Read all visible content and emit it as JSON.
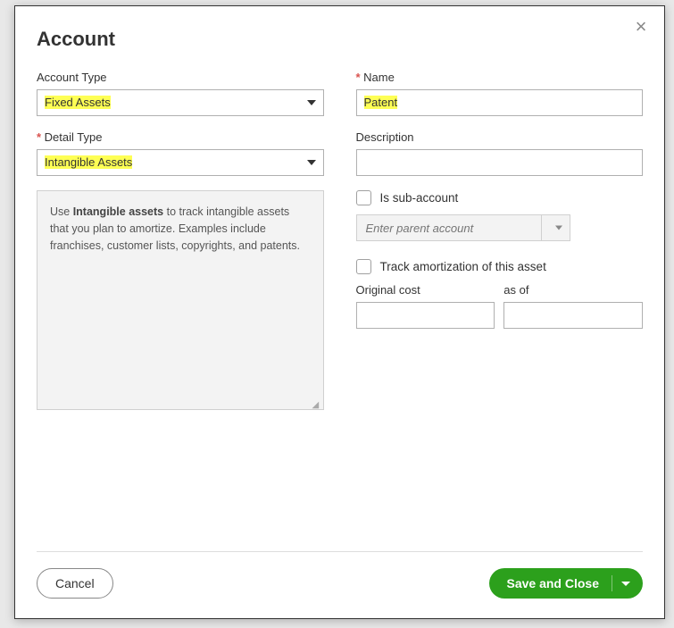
{
  "modal": {
    "title": "Account"
  },
  "left": {
    "account_type_label": "Account Type",
    "account_type_value": "Fixed Assets",
    "detail_type_label": "Detail Type",
    "detail_type_value": "Intangible Assets",
    "info_prefix": "Use ",
    "info_bold": "Intangible assets",
    "info_rest": " to track intangible assets that you plan to amortize. Examples include franchises, customer lists, copyrights, and patents."
  },
  "right": {
    "name_label": "Name",
    "name_value": "Patent",
    "description_label": "Description",
    "description_value": "",
    "is_sub_label": "Is sub-account",
    "parent_placeholder": "Enter parent account",
    "track_amort_label": "Track amortization of this asset",
    "original_cost_label": "Original cost",
    "as_of_label": "as of",
    "original_cost_value": "",
    "as_of_value": ""
  },
  "footer": {
    "cancel": "Cancel",
    "save": "Save and Close"
  }
}
